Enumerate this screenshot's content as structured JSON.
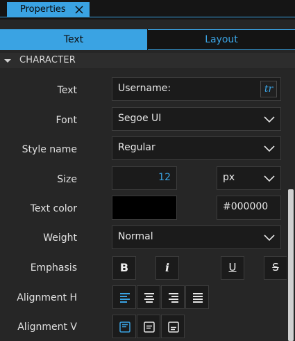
{
  "panel_tab": {
    "label": "Properties"
  },
  "subtabs": {
    "text": "Text",
    "layout": "Layout"
  },
  "section": {
    "title": "CHARACTER"
  },
  "rows": {
    "text": {
      "label": "Text",
      "value": "Username:",
      "translate_glyph": "tr"
    },
    "font": {
      "label": "Font",
      "value": "Segoe UI"
    },
    "style_name": {
      "label": "Style name",
      "value": "Regular"
    },
    "size": {
      "label": "Size",
      "value": "12",
      "unit": "px"
    },
    "text_color": {
      "label": "Text color",
      "hex": "#000000"
    },
    "weight": {
      "label": "Weight",
      "value": "Normal"
    },
    "emphasis": {
      "label": "Emphasis",
      "bold": "B",
      "italic": "i",
      "underline": "U",
      "strike": "S"
    },
    "alignment_h": {
      "label": "Alignment H"
    },
    "alignment_v": {
      "label": "Alignment V"
    }
  },
  "colors": {
    "accent": "#3aa3e3",
    "swatch": "#000000"
  }
}
